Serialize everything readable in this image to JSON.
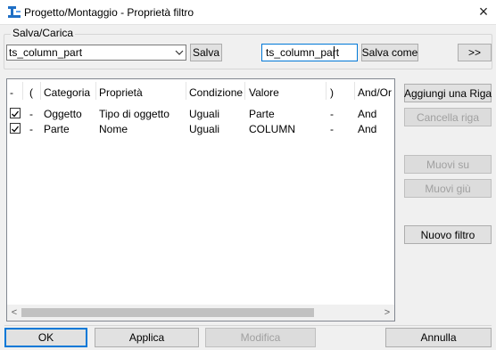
{
  "window": {
    "title": "Progetto/Montaggio - Proprietà filtro",
    "close_glyph": "×"
  },
  "save_load": {
    "group_label": "Salva/Carica",
    "combo_value": "ts_column_part",
    "save_label": "Salva",
    "name_value": "ts_column_part",
    "save_as_label": "Salva come",
    "expand_label": ">>"
  },
  "table": {
    "headers": [
      "-",
      "(",
      "Categoria",
      "Proprietà",
      "Condizione",
      "Valore",
      ")",
      "And/Or"
    ],
    "rows": [
      {
        "checked": true,
        "dash": "-",
        "categoria": "Oggetto",
        "proprieta": "Tipo di oggetto",
        "condizione": "Uguali",
        "valore": "Parte",
        "close": "-",
        "andor": "And"
      },
      {
        "checked": true,
        "dash": "-",
        "categoria": "Parte",
        "proprieta": "Nome",
        "condizione": "Uguali",
        "valore": "COLUMN",
        "close": "-",
        "andor": "And"
      }
    ]
  },
  "side_buttons": {
    "add_row": "Aggiungi una Riga",
    "delete_row": "Cancella riga",
    "move_up": "Muovi su",
    "move_down": "Muovi giù",
    "new_filter": "Nuovo filtro"
  },
  "bottom_buttons": {
    "ok": "OK",
    "apply": "Applica",
    "modify": "Modifica",
    "cancel": "Annulla"
  },
  "scrollbar": {
    "left_glyph": "<",
    "right_glyph": ">"
  }
}
